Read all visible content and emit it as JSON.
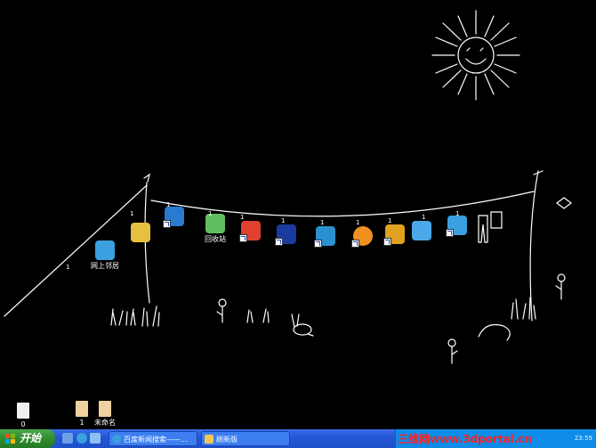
{
  "desktop": {
    "icons": [
      {
        "id": "network-neighborhood",
        "label": "网上邻居",
        "icon": "network-computer-icon",
        "color": "#3aa0e0"
      },
      {
        "id": "outlook-express",
        "label": "",
        "icon": "mail-envelope-icon",
        "color": "#e8c040"
      },
      {
        "id": "sc-app",
        "label": "",
        "icon": "sc-app-icon",
        "color": "#2a7ad0"
      },
      {
        "id": "recycle-bin",
        "label": "回收站",
        "icon": "recycle-bin-icon",
        "color": "#60c060"
      },
      {
        "id": "security-app",
        "label": "",
        "icon": "shield-icon",
        "color": "#e04030"
      },
      {
        "id": "blackberry-app",
        "label": "",
        "icon": "blackberry-icon",
        "color": "#1a3aa0"
      },
      {
        "id": "ie-like-app",
        "label": "",
        "icon": "disc-icon",
        "color": "#2a90d0"
      },
      {
        "id": "smiley-app",
        "label": "",
        "icon": "smiley-icon",
        "color": "#f09020"
      },
      {
        "id": "qq-app",
        "label": "",
        "icon": "qq-penguin-icon",
        "color": "#e0a020"
      },
      {
        "id": "my-computer",
        "label": "",
        "icon": "computer-icon",
        "color": "#4aa8e8"
      },
      {
        "id": "feather-app",
        "label": "",
        "icon": "feather-icon",
        "color": "#3aa0e0"
      }
    ],
    "clothesline_tags": [
      "1",
      "1",
      "1",
      "1",
      "1",
      "1",
      "1",
      "1",
      "1",
      "1",
      "1"
    ],
    "bottom_files": [
      {
        "label": "0",
        "icon": "document-icon"
      },
      {
        "label": "1",
        "icon": "document-icon"
      },
      {
        "label": "未命名",
        "icon": "document-icon"
      }
    ]
  },
  "taskbar": {
    "start_label": "开始",
    "quick_launch": [
      "desktop-icon",
      "ie-icon",
      "media-icon"
    ],
    "tasks": [
      {
        "label": "百度新闻搜索——...",
        "icon": "ie-icon"
      },
      {
        "label": "刷新版",
        "icon": "folder-icon"
      }
    ],
    "watermark": "三维网www.3dportal.cn",
    "clock": "23:59"
  },
  "colors": {
    "taskbar": "#2457d6",
    "start": "#2e8b2e",
    "tray": "#0f8be8",
    "watermark": "#ff2020"
  }
}
